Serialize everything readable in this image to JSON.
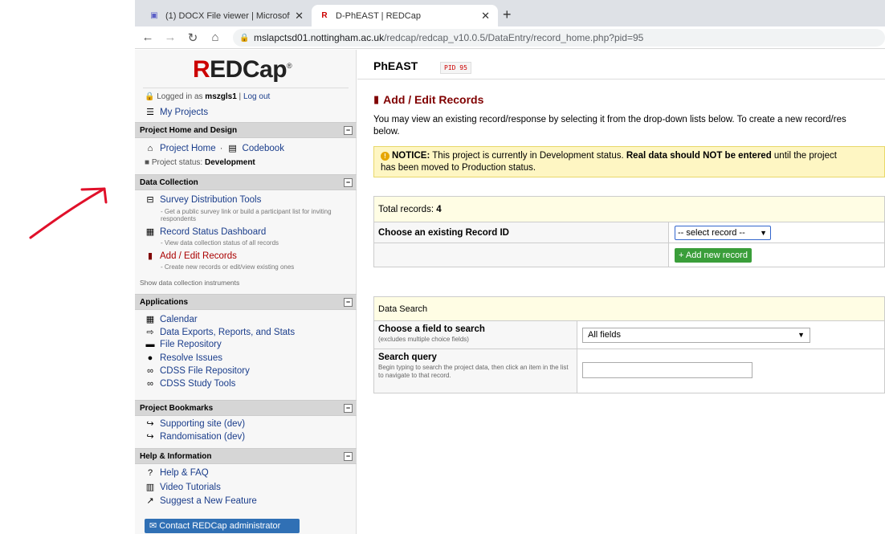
{
  "browser": {
    "tabs": [
      {
        "title": "(1) DOCX File viewer | Microsoft",
        "icon": "teams-icon",
        "color": "#5b5fc7"
      },
      {
        "title": "D-PhEAST | REDCap",
        "icon": "redcap-icon",
        "color": "#cc0000"
      }
    ],
    "url_host": "mslapctsd01.nottingham.ac.uk",
    "url_path": "/redcap/redcap_v10.0.5/DataEntry/record_home.php?pid=95"
  },
  "sidebar": {
    "logo": {
      "r": "R",
      "rest": "EDCap",
      "mark": "®"
    },
    "logged_in_prefix": "Logged in as",
    "username": "mszgls1",
    "separator": "|",
    "logout": "Log out",
    "my_projects": "My Projects",
    "sections": {
      "home": {
        "title": "Project Home and Design",
        "project_home": "Project Home",
        "dot": "·",
        "codebook": "Codebook",
        "status_label": "Project status:",
        "status_value": "Development"
      },
      "data_collection": {
        "title": "Data Collection",
        "items": [
          {
            "label": "Survey Distribution Tools",
            "sub": "- Get a public survey link or build a participant list for inviting respondents"
          },
          {
            "label": "Record Status Dashboard",
            "sub": "- View data collection status of all records"
          },
          {
            "label": "Add / Edit Records",
            "sub": "- Create new records or edit/view existing ones"
          }
        ],
        "show_instruments": "Show data collection instruments"
      },
      "applications": {
        "title": "Applications",
        "items": [
          "Calendar",
          "Data Exports, Reports, and Stats",
          "File Repository",
          "Resolve Issues",
          "CDSS File Repository",
          "CDSS Study Tools"
        ]
      },
      "bookmarks": {
        "title": "Project Bookmarks",
        "items": [
          "Supporting site (dev)",
          "Randomisation (dev)"
        ]
      },
      "help": {
        "title": "Help & Information",
        "items": [
          "Help & FAQ",
          "Video Tutorials",
          "Suggest a New Feature"
        ]
      }
    },
    "contact_button": "Contact REDCap administrator"
  },
  "main": {
    "project_title": "PhEAST",
    "pid": "PID 95",
    "page_heading": "Add / Edit Records",
    "intro_line1": "You may view an existing record/response by selecting it from the drop-down lists below. To create a new record/res",
    "intro_line2": "below.",
    "notice": {
      "label": "NOTICE:",
      "text1": " This project is currently in Development status. ",
      "bold": "Real data should NOT be entered",
      "text2": " until the project",
      "line2": "has been moved to Production status."
    },
    "records": {
      "total_label": "Total records:",
      "total_value": "4",
      "choose_label": "Choose an existing Record ID",
      "select_placeholder": "-- select record --",
      "add_button": "Add new record"
    },
    "search": {
      "header": "Data Search",
      "field_label": "Choose a field to search",
      "field_sub": "(excludes multiple choice fields)",
      "field_value": "All fields",
      "query_label": "Search query",
      "query_sub": "Begin typing to search the project data, then click an item in the list to navigate to that record."
    }
  },
  "colors": {
    "accent_red": "#cc0000",
    "heading_maroon": "#800000",
    "link_blue": "#1a3d8b",
    "button_green": "#3a9e3a",
    "button_blue": "#3070b5",
    "notice_bg": "#fef6c3"
  }
}
